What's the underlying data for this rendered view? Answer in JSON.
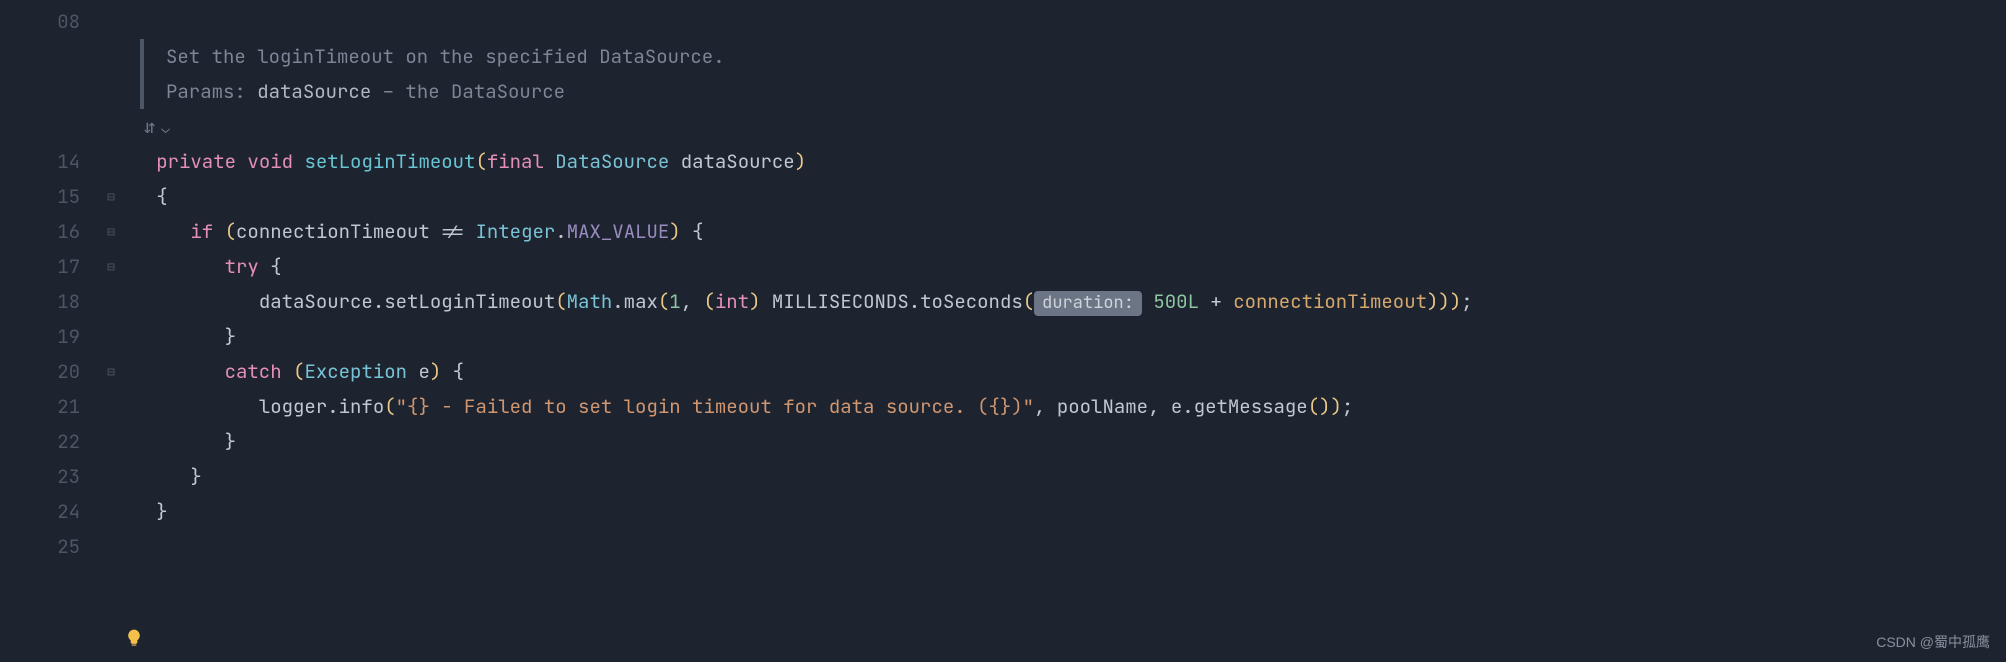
{
  "gutter": {
    "start": 8,
    "line_numbers": [
      "08",
      "",
      "",
      "",
      "",
      "",
      "14",
      "15",
      "16",
      "17",
      "18",
      "19",
      "20",
      "21",
      "22",
      "23",
      "24",
      "25"
    ]
  },
  "doc": {
    "line1": "Set the loginTimeout on the specified DataSource.",
    "params_label": "Params:",
    "param_name": "dataSource",
    "param_desc": " – the DataSource"
  },
  "gutter_icon": {
    "label": "⇵",
    "chev": "⌄"
  },
  "code": {
    "kw_private": "private",
    "kw_void": "void",
    "method_name": "setLoginTimeout",
    "kw_final": "final",
    "type_ds": "DataSource",
    "param_ds": "dataSource",
    "open_brace": "{",
    "close_brace": "}",
    "kw_if": "if",
    "if_cond_lhs": "connectionTimeout",
    "if_op": "!=",
    "type_integer": "Integer",
    "max_value": "MAX_VALUE",
    "kw_try": "try",
    "call_target": "dataSource",
    "call_setLogin": "setLoginTimeout",
    "type_math": "Math",
    "call_max": "max",
    "num_1": "1",
    "cast_int": "int",
    "milliseconds": "MILLISECONDS",
    "toSeconds": "toSeconds",
    "hint_duration": "duration:",
    "num_500L": "500L",
    "plus": "+",
    "conn_timeout2": "connectionTimeout",
    "kw_catch": "catch",
    "type_exception": "Exception",
    "param_e": "e",
    "logger": "logger",
    "info": "info",
    "log_str": "\"{} - Failed to set login timeout for data source. ({})\"",
    "poolName": "poolName",
    "e": "e",
    "getMessage": "getMessage"
  },
  "watermark": "CSDN @蜀中孤鹰"
}
